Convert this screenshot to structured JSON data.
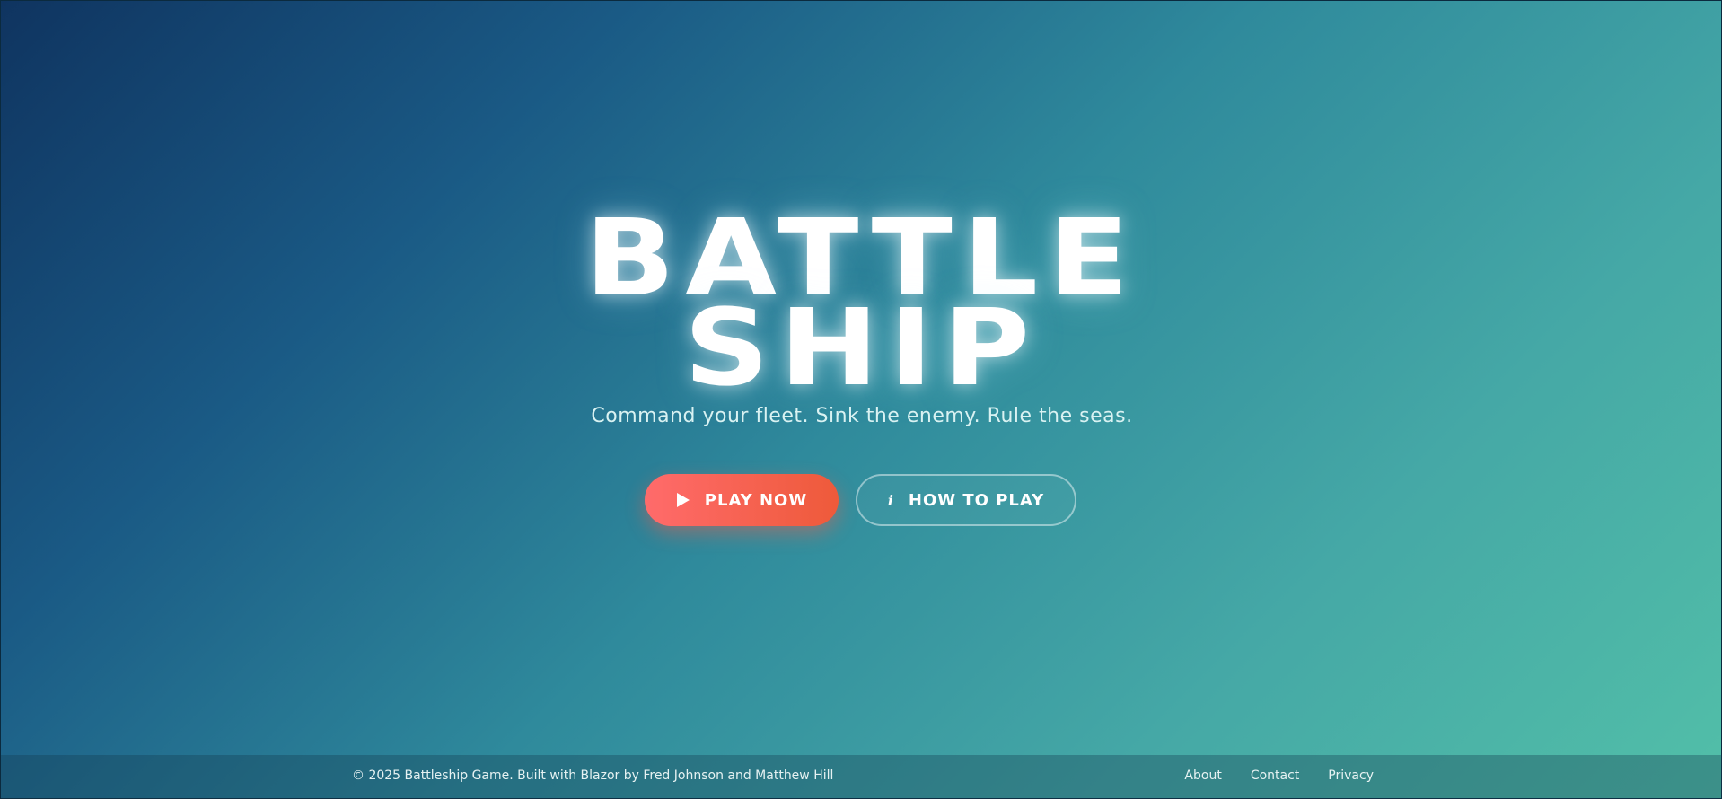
{
  "hero": {
    "title_line_1": "BATTLE",
    "title_line_2": "SHIP",
    "tagline": "Command your fleet. Sink the enemy. Rule the seas."
  },
  "buttons": {
    "play": {
      "label": "PLAY NOW",
      "icon": "play-icon",
      "color_start": "#ff6b6b",
      "color_end": "#ee5a3a"
    },
    "how_to_play": {
      "label": "HOW TO PLAY",
      "icon": "info-icon",
      "icon_glyph": "i"
    }
  },
  "footer": {
    "copyright": "© 2025 Battleship Game. Built with Blazor by Fred Johnson and Matthew Hill",
    "links": [
      "About",
      "Contact",
      "Privacy"
    ]
  },
  "colors": {
    "gradient_start": "#0f3460",
    "gradient_end": "#52bfa8",
    "accent": "#ff6b6b"
  }
}
